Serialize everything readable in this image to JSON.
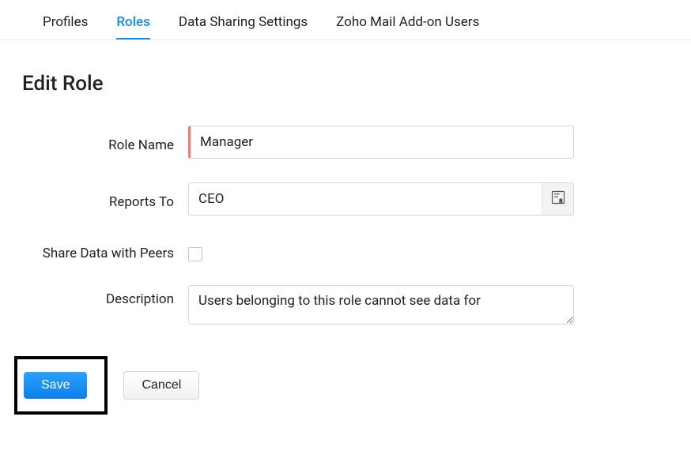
{
  "tabs": {
    "profiles": "Profiles",
    "roles": "Roles",
    "data_sharing": "Data Sharing Settings",
    "mail_addon": "Zoho Mail Add-on Users"
  },
  "page_title": "Edit Role",
  "form": {
    "role_name_label": "Role Name",
    "role_name_value": "Manager",
    "reports_to_label": "Reports To",
    "reports_to_value": "CEO",
    "share_peers_label": "Share Data with Peers",
    "share_peers_checked": false,
    "description_label": "Description",
    "description_value": "Users belonging to this role cannot see data for"
  },
  "buttons": {
    "save": "Save",
    "cancel": "Cancel"
  }
}
